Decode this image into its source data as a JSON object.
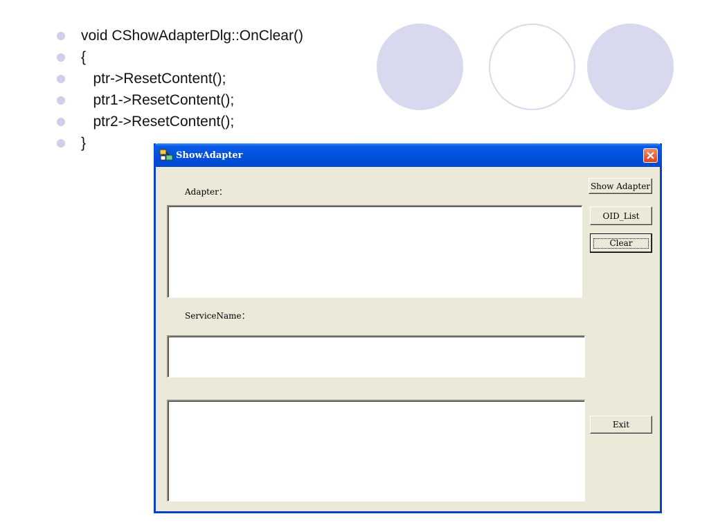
{
  "slide": {
    "code_lines": [
      "void CShowAdapterDlg::OnClear()",
      "{",
      "   ptr->ResetContent();",
      "   ptr1->ResetContent();",
      "   ptr2->ResetContent();",
      "}"
    ],
    "colors": {
      "bullet": "#cfcfea",
      "circle_fill": "#d8d8ee"
    }
  },
  "dialog": {
    "title": "ShowAdapter",
    "labels": {
      "adapter": "Adapter：",
      "service_name": "ServiceName："
    },
    "buttons": {
      "show_adapter": "Show Adapter",
      "oid_list": "OID_List",
      "clear": "Clear",
      "exit": "Exit"
    },
    "icons": {
      "app": "network-adapter-icon",
      "close": "close-icon"
    },
    "colors": {
      "titlebar": "#0250da",
      "face": "#ece9d8",
      "close": "#d8461c"
    }
  }
}
